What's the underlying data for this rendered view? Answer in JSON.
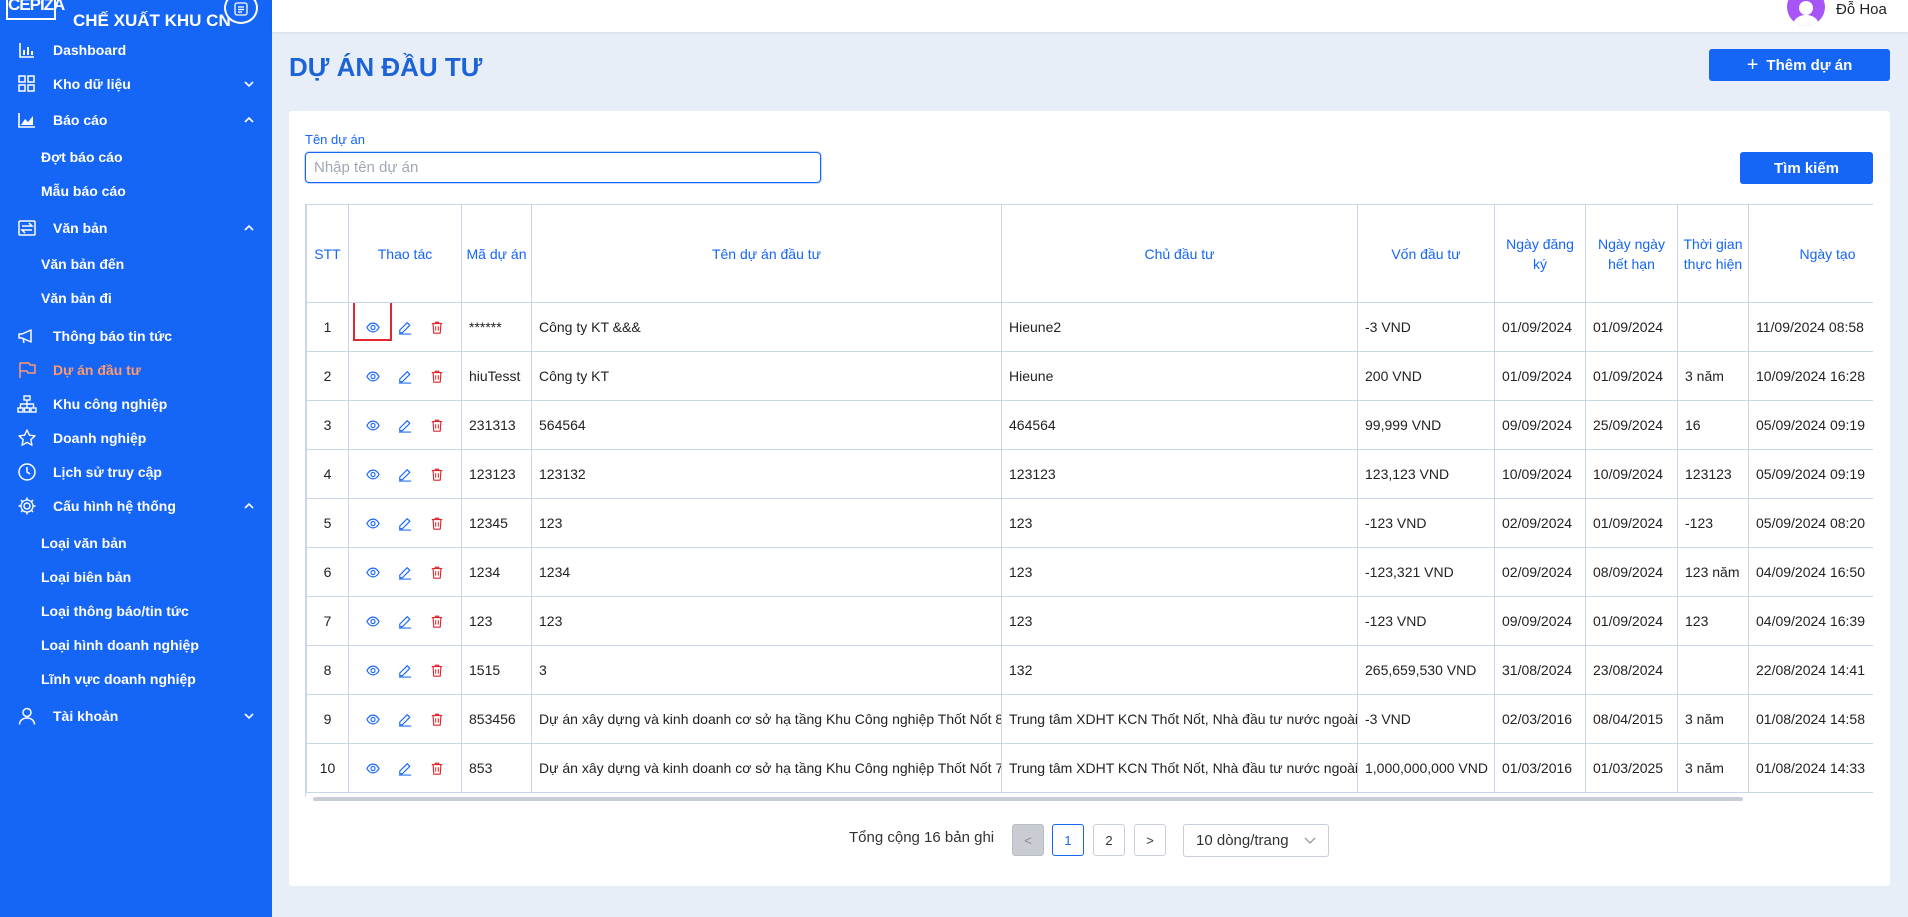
{
  "brand": {
    "logo_text": "CEPIZA",
    "name": "CHẾ XUẤT KHU CN"
  },
  "sidebar": {
    "items": [
      {
        "label": "Dashboard",
        "icon": "bar-chart-icon"
      },
      {
        "label": "Kho dữ liệu",
        "icon": "grid-icon"
      },
      {
        "label": "Báo cáo",
        "icon": "area-chart-icon"
      },
      {
        "label": "Đợt báo cáo"
      },
      {
        "label": "Mẫu báo cáo"
      },
      {
        "label": "Văn bản",
        "icon": "swap-icon"
      },
      {
        "label": "Văn bản đến"
      },
      {
        "label": "Văn bản đi"
      },
      {
        "label": "Thông báo tin tức",
        "icon": "megaphone-icon"
      },
      {
        "label": "Dự án đầu tư",
        "icon": "flag-icon"
      },
      {
        "label": "Khu công nghiệp",
        "icon": "sitemap-icon"
      },
      {
        "label": "Doanh nghiệp",
        "icon": "star-icon"
      },
      {
        "label": "Lịch sử truy cập",
        "icon": "clock-icon"
      },
      {
        "label": "Cấu hình hệ thống",
        "icon": "gear-icon"
      },
      {
        "label": "Loại văn bản"
      },
      {
        "label": "Loại biên bản"
      },
      {
        "label": "Loại thông báo/tin tức"
      },
      {
        "label": "Loại hình doanh nghiệp"
      },
      {
        "label": "Lĩnh vực doanh nghiệp"
      },
      {
        "label": "Tài khoản",
        "icon": "user-icon"
      }
    ],
    "active_color": "#ff9a6b"
  },
  "topbar": {
    "user_name": "Đỗ Hoa"
  },
  "page": {
    "title": "DỰ ÁN ĐẦU TƯ",
    "add_button": "Thêm dự án"
  },
  "filter": {
    "label": "Tên dự án",
    "placeholder": "Nhập tên dự án",
    "value": "",
    "search_button": "Tìm kiếm"
  },
  "table": {
    "headers": {
      "stt": "STT",
      "actions": "Thao tác",
      "code": "Mã dự án",
      "name": "Tên dự án đầu tư",
      "owner": "Chủ đầu tư",
      "capital": "Vốn đầu tư",
      "reg_date": "Ngày đăng ký",
      "exp_date": "Ngày ngày hết hạn",
      "duration": "Thời gian thực hiện",
      "created": "Ngày tạo"
    },
    "rows": [
      {
        "stt": "1",
        "code": "******",
        "name": "Công ty KT &&&",
        "owner": "Hieune2",
        "capital": "-3 VND",
        "reg_date": "01/09/2024",
        "exp_date": "01/09/2024",
        "duration": "",
        "created": "11/09/2024 08:58"
      },
      {
        "stt": "2",
        "code": "hiuTesst",
        "name": "Công ty KT",
        "owner": "Hieune",
        "capital": "200 VND",
        "reg_date": "01/09/2024",
        "exp_date": "01/09/2024",
        "duration": "3 năm",
        "created": "10/09/2024 16:28"
      },
      {
        "stt": "3",
        "code": "231313",
        "name": "564564",
        "owner": "464564",
        "capital": "99,999 VND",
        "reg_date": "09/09/2024",
        "exp_date": "25/09/2024",
        "duration": "16",
        "created": "05/09/2024 09:19"
      },
      {
        "stt": "4",
        "code": "123123",
        "name": "123132",
        "owner": "123123",
        "capital": "123,123 VND",
        "reg_date": "10/09/2024",
        "exp_date": "10/09/2024",
        "duration": "123123",
        "created": "05/09/2024 09:19"
      },
      {
        "stt": "5",
        "code": "12345",
        "name": "123",
        "owner": "123",
        "capital": "-123 VND",
        "reg_date": "02/09/2024",
        "exp_date": "01/09/2024",
        "duration": "-123",
        "created": "05/09/2024 08:20"
      },
      {
        "stt": "6",
        "code": "1234",
        "name": "1234",
        "owner": "123",
        "capital": "-123,321 VND",
        "reg_date": "02/09/2024",
        "exp_date": "08/09/2024",
        "duration": "123 năm",
        "created": "04/09/2024 16:50"
      },
      {
        "stt": "7",
        "code": "123",
        "name": "123",
        "owner": "123",
        "capital": "-123 VND",
        "reg_date": "09/09/2024",
        "exp_date": "01/09/2024",
        "duration": "123",
        "created": "04/09/2024 16:39"
      },
      {
        "stt": "8",
        "code": "1515",
        "name": "3",
        "owner": "132",
        "capital": "265,659,530 VND",
        "reg_date": "31/08/2024",
        "exp_date": "23/08/2024",
        "duration": "",
        "created": "22/08/2024 14:41"
      },
      {
        "stt": "9",
        "code": "853456",
        "name": "Dự án xây dựng và kinh doanh cơ sở hạ tầng Khu Công nghiệp Thốt Nốt 8",
        "owner": "Trung tâm XDHT KCN Thốt Nốt, Nhà đầu tư nước ngoài",
        "capital": "-3 VND",
        "reg_date": "02/03/2016",
        "exp_date": "08/04/2015",
        "duration": "3 năm",
        "created": "01/08/2024 14:58"
      },
      {
        "stt": "10",
        "code": "853",
        "name": "Dự án xây dựng và kinh doanh cơ sở hạ tầng Khu Công nghiệp Thốt Nốt 7",
        "owner": "Trung tâm XDHT KCN Thốt Nốt, Nhà đầu tư nước ngoài",
        "capital": "1,000,000,000 VND",
        "reg_date": "01/03/2016",
        "exp_date": "01/03/2025",
        "duration": "3 năm",
        "created": "01/08/2024 14:33"
      }
    ]
  },
  "pagination": {
    "total_text": "Tổng cộng 16 bản ghi",
    "prev": "<",
    "pages": [
      "1",
      "2"
    ],
    "current": "1",
    "next": ">",
    "page_size": "10 dòng/trang"
  },
  "colors": {
    "primary": "#1565f7",
    "title": "#1d63d8",
    "delete": "#e0262e",
    "highlight": "#e0262e"
  }
}
